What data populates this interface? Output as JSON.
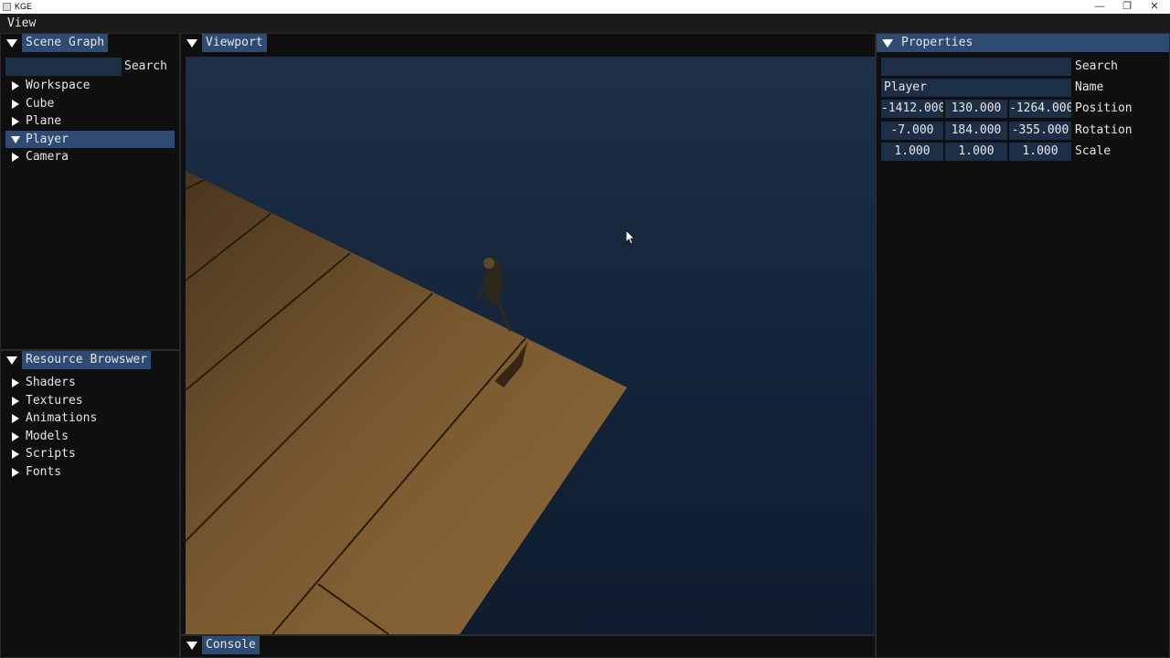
{
  "window": {
    "title": "KGE",
    "minimize": "—",
    "maximize": "❐",
    "close": "✕"
  },
  "menu": {
    "view": "View"
  },
  "scene_graph": {
    "title": "Scene Graph",
    "search_label": "Search",
    "search_value": "",
    "items": [
      {
        "label": "Workspace",
        "expanded": false,
        "selected": false
      },
      {
        "label": "Cube",
        "expanded": false,
        "selected": false
      },
      {
        "label": "Plane",
        "expanded": false,
        "selected": false
      },
      {
        "label": "Player",
        "expanded": true,
        "selected": true
      },
      {
        "label": "Camera",
        "expanded": false,
        "selected": false
      }
    ]
  },
  "resource_browser": {
    "title": "Resource Browswer",
    "items": [
      {
        "label": "Shaders"
      },
      {
        "label": "Textures"
      },
      {
        "label": "Animations"
      },
      {
        "label": "Models"
      },
      {
        "label": "Scripts"
      },
      {
        "label": "Fonts"
      }
    ]
  },
  "viewport": {
    "title": "Viewport"
  },
  "console": {
    "title": "Console"
  },
  "properties": {
    "title": "Properties",
    "search_label": "Search",
    "search_value": "",
    "name_label": "Name",
    "name_value": "Player",
    "position_label": "Position",
    "position": [
      "-1412.000",
      "130.000",
      "-1264.000"
    ],
    "rotation_label": "Rotation",
    "rotation": [
      "-7.000",
      "184.000",
      "-355.000"
    ],
    "scale_label": "Scale",
    "scale": [
      "1.000",
      "1.000",
      "1.000"
    ]
  },
  "colors": {
    "accent": "#2d4b73",
    "field_bg": "#1d2f47",
    "panel_bg": "#0f0f0f",
    "water": "#142235",
    "deck": "#7a5a30"
  }
}
